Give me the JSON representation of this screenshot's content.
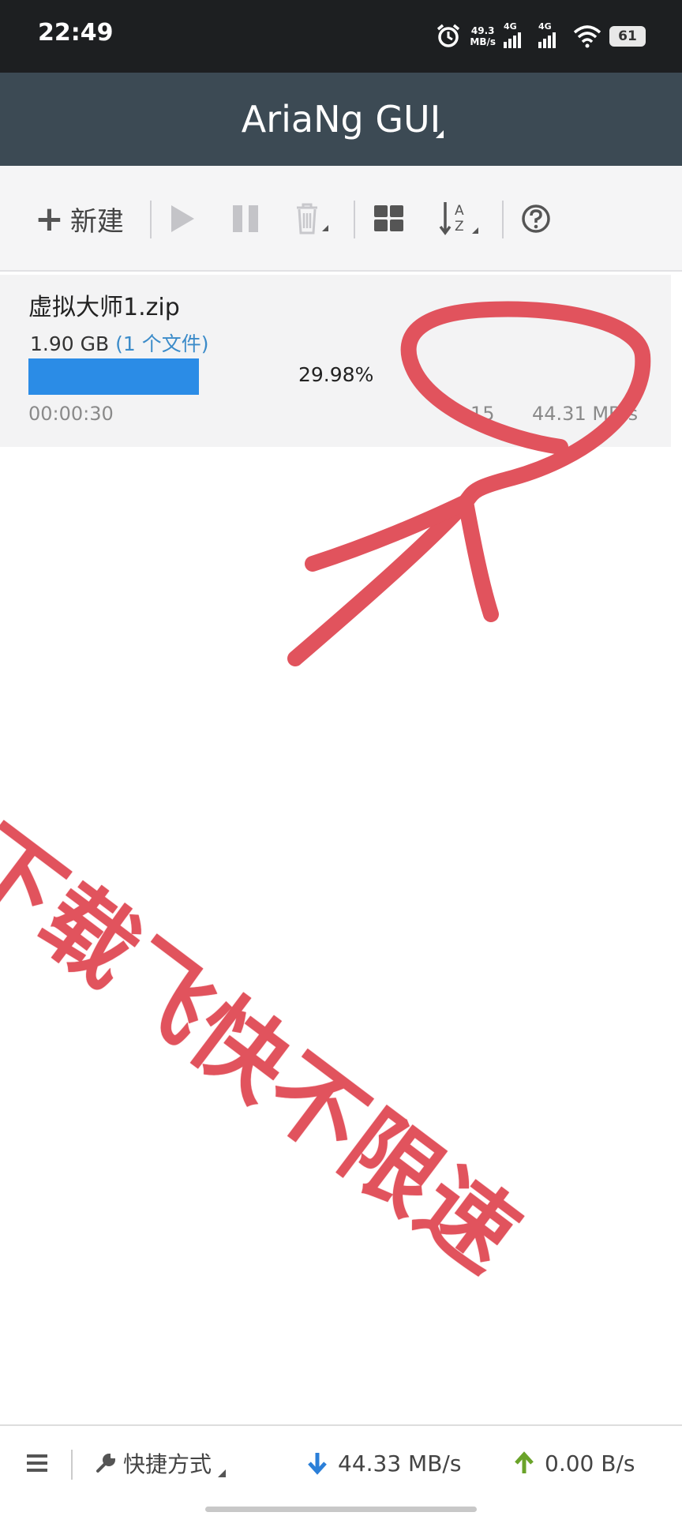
{
  "status_bar": {
    "time": "22:49",
    "net_speed_value": "49.3",
    "net_speed_unit": "MB/s",
    "sim1": "4G",
    "sim2": "4G",
    "battery": "61"
  },
  "app_bar": {
    "title": "AriaNg GUI"
  },
  "toolbar": {
    "new_label": "新建",
    "icons": [
      "plus-icon",
      "play-icon",
      "pause-icon",
      "trash-icon",
      "grid-icon",
      "sort-az-icon",
      "help-icon"
    ]
  },
  "task": {
    "name": "虚拟大师1.zip",
    "size": "1.90 GB",
    "files": "(1 个文件)",
    "progress_percent": 29.98,
    "progress_label": "29.98%",
    "elapsed": "00:00:30",
    "connections": "15",
    "speed": "44.31 MB/s"
  },
  "overlay": {
    "text": "下载飞快不限速",
    "color": "#e1535d"
  },
  "bottom_bar": {
    "shortcut_label": "快捷方式",
    "download_speed": "44.33 MB/s",
    "upload_speed": "0.00 B/s",
    "download_color": "#2b7fd8",
    "upload_color": "#6aa329"
  }
}
